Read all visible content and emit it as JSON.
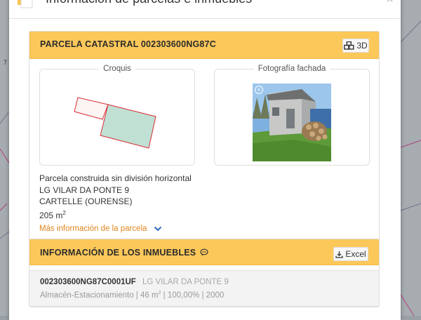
{
  "map": {
    "side_label": "7"
  },
  "modal": {
    "title": "Información de parcelas e inmuebles",
    "close_glyph": "×"
  },
  "parcel": {
    "title": "PARCELA CATASTRAL 002303600NG87C",
    "btn_3d_label": "3D",
    "croquis_label": "Croquis",
    "foto_label": "Fotografía fachada",
    "photo_zoom_glyph": "+",
    "type_text": "Parcela construida sin división horizontal",
    "address": "LG VILAR DA PONTE 9",
    "municipality": "CARTELLE (OURENSE)",
    "area_value": "205 m",
    "area_exp": "2",
    "more_link": "Más información de la parcela"
  },
  "inmuebles": {
    "title": "INFORMACIÓN DE LOS INMUEBLES",
    "excel_label": "Excel",
    "rows": [
      {
        "ref": "002303600NG87C0001UF",
        "address": "LG VILAR DA PONTE 9",
        "use": "Almacén-Estacionamiento",
        "area": "46 m",
        "area_exp": "2",
        "participation": "100,00%",
        "year": "2000"
      }
    ]
  },
  "colors": {
    "header_bg": "#fcc85a",
    "link": "#e0861c",
    "chevron": "#2a6cc0",
    "parcel_fill": "#bfe0d3",
    "parcel_stroke": "#d92b32"
  }
}
